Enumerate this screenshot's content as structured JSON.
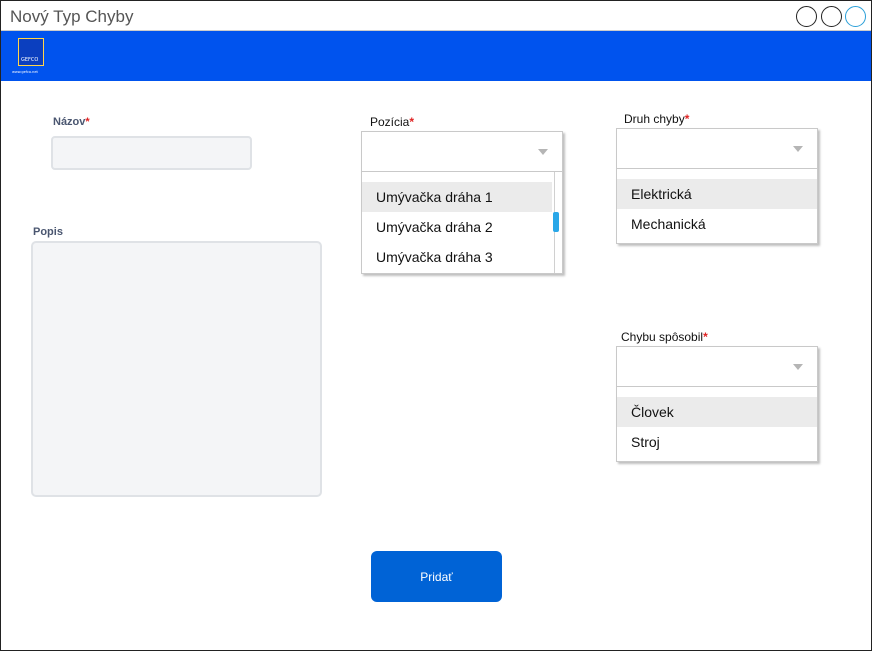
{
  "window": {
    "title": "Nový Typ Chyby"
  },
  "appbar": {
    "logo_text": "GEFCO",
    "logo_subtext": "www.gefco.net"
  },
  "form": {
    "nazov": {
      "label": "Názov",
      "required_mark": "*",
      "value": ""
    },
    "popis": {
      "label": "Popis",
      "value": ""
    },
    "pozicia": {
      "label": "Pozícia",
      "required_mark": "*",
      "selected": "",
      "options": [
        "Umývačka dráha 1",
        "Umývačka dráha 2",
        "Umývačka dráha 3"
      ]
    },
    "druh_chyby": {
      "label": "Druh chyby",
      "required_mark": "*",
      "selected": "",
      "options": [
        "Elektrická",
        "Mechanická"
      ]
    },
    "chybu_sposobil": {
      "label": "Chybu spôsobil",
      "required_mark": "*",
      "selected": "",
      "options": [
        "Človek",
        "Stroj"
      ]
    },
    "submit_label": "Pridať"
  },
  "colors": {
    "appbar": "#0053ee",
    "button": "#0063d6",
    "required": "#e02424",
    "scroll_thumb": "#29a7e8"
  }
}
